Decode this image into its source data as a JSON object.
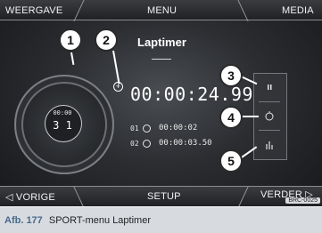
{
  "top_tabs": {
    "left": "WEERGAVE",
    "center": "MENU",
    "right": "MEDIA"
  },
  "bottom_tabs": {
    "left": "◁  VORIGE",
    "center": "SETUP",
    "right": "VERDER  ▷"
  },
  "title": "Laptimer",
  "dial": {
    "time": "00:00",
    "lap": "3 1"
  },
  "main_time": "00:00:24.99",
  "laps": [
    {
      "num": "01",
      "time": "00:00:02"
    },
    {
      "num": "02",
      "time": "00:00:03.50"
    }
  ],
  "markers": [
    "1",
    "2",
    "3",
    "4",
    "5"
  ],
  "panel_icons": [
    "pause-icon",
    "stopwatch-icon",
    "bar-chart-icon"
  ],
  "code": "BRC-0025",
  "caption": {
    "label": "Afb. 177",
    "text": "SPORT-menu Laptimer"
  }
}
